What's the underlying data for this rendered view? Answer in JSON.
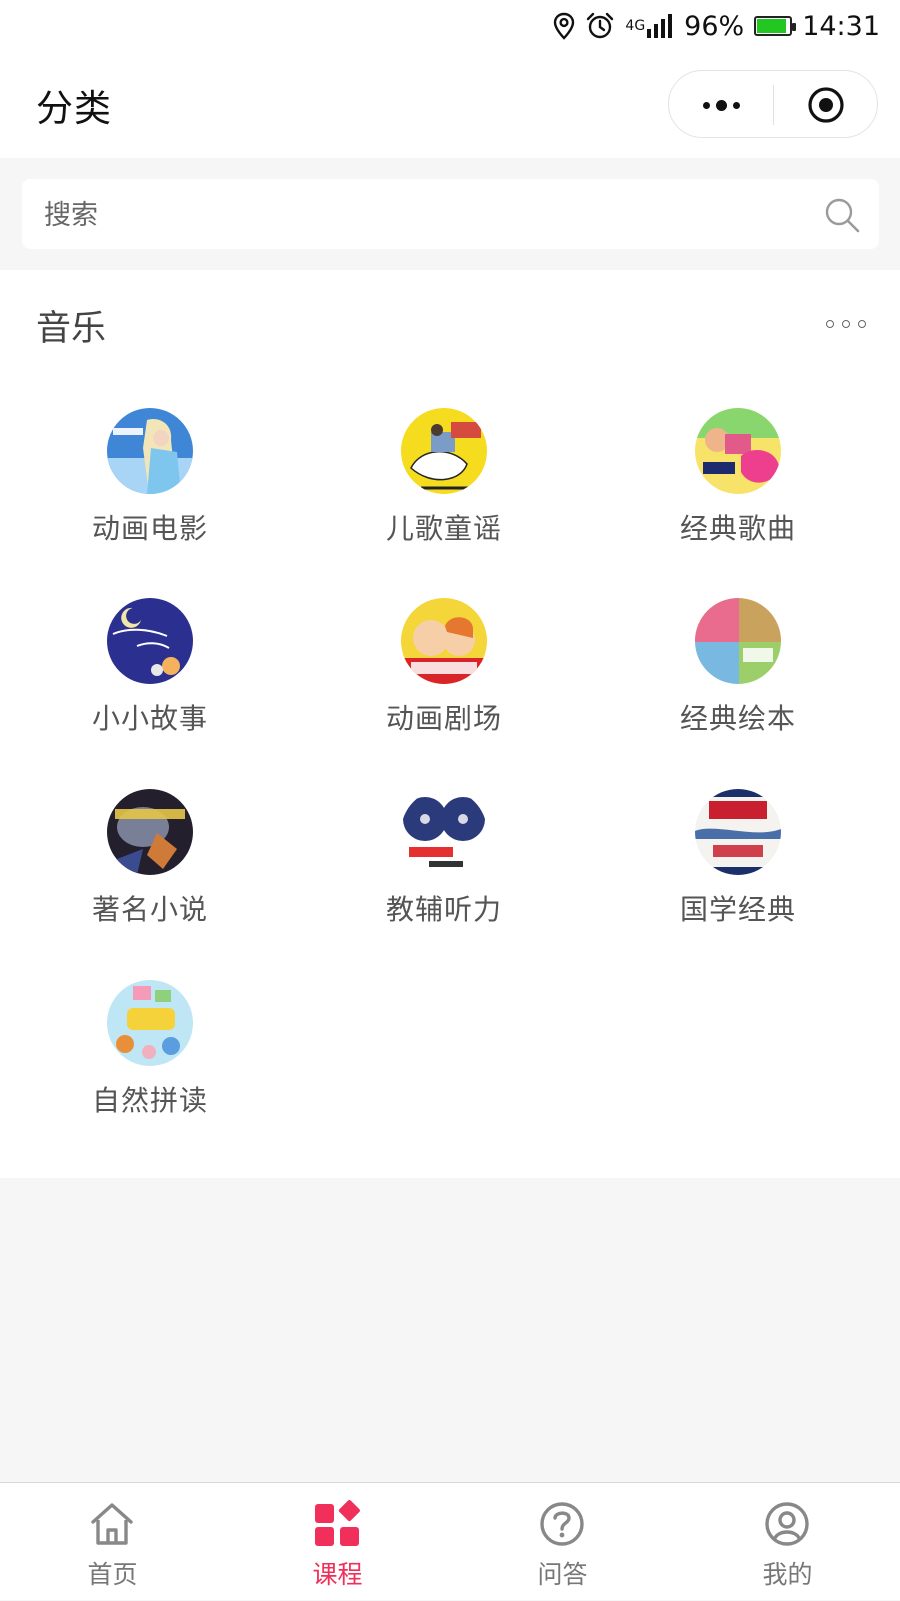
{
  "status_bar": {
    "network": "4G",
    "battery_percent": "96%",
    "battery_level": 0.96,
    "time": "14:31",
    "icons": [
      "location-icon",
      "alarm-icon",
      "signal-icon",
      "battery-icon"
    ]
  },
  "nav": {
    "title": "分类",
    "capsule": {
      "more_icon": "more-dots-icon",
      "close_icon": "target-close-icon"
    }
  },
  "search": {
    "placeholder": "搜索",
    "value": "",
    "icon": "search-icon"
  },
  "section": {
    "title": "音乐",
    "more_icon": "more-circles-icon",
    "items": [
      {
        "label": "动画电影",
        "thumb": "frozen-cover"
      },
      {
        "label": "儿歌童谣",
        "thumb": "mother-goose-cover"
      },
      {
        "label": "经典歌曲",
        "thumb": "pinkfong-cover"
      },
      {
        "label": "小小故事",
        "thumb": "english-story-cover"
      },
      {
        "label": "动画剧场",
        "thumb": "caillou-cover"
      },
      {
        "label": "经典绘本",
        "thumb": "picture-book-cover"
      },
      {
        "label": "著名小说",
        "thumb": "harry-potter-cover"
      },
      {
        "label": "教辅听力",
        "thumb": "super-tots-cover"
      },
      {
        "label": "国学经典",
        "thumb": "guoxue-cover"
      },
      {
        "label": "自然拼读",
        "thumb": "phonics-cover"
      }
    ]
  },
  "tabs": [
    {
      "label": "首页",
      "icon": "home-icon",
      "active": false
    },
    {
      "label": "课程",
      "icon": "course-grid-icon",
      "active": true
    },
    {
      "label": "问答",
      "icon": "question-icon",
      "active": false
    },
    {
      "label": "我的",
      "icon": "profile-icon",
      "active": false
    }
  ],
  "colors": {
    "accent": "#f0305a",
    "battery": "#22c722",
    "background": "#f6f6f6"
  }
}
